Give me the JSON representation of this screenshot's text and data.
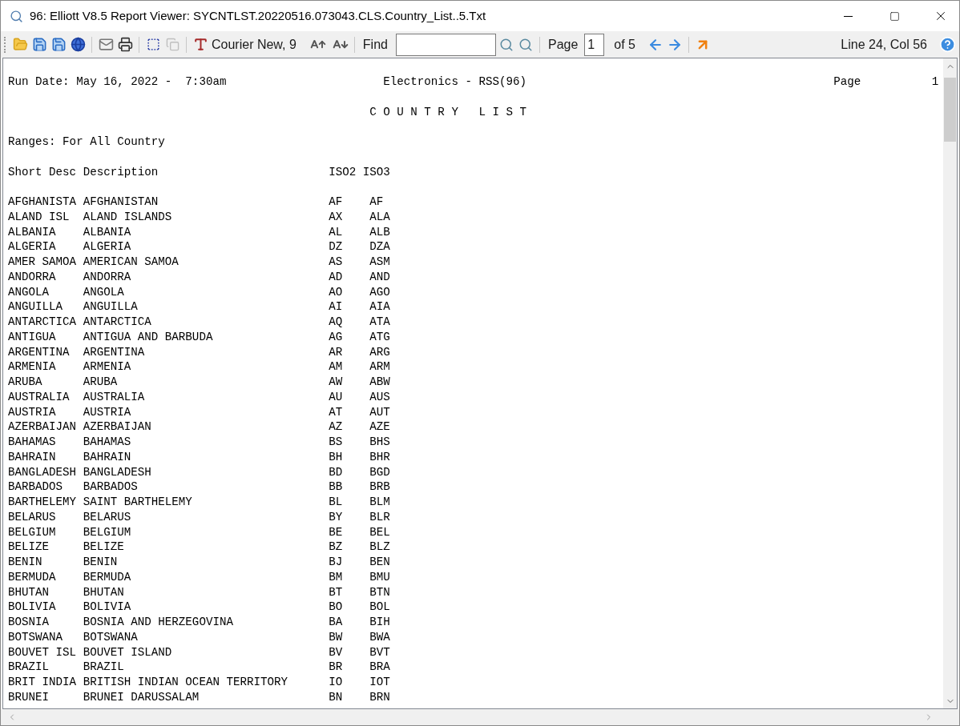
{
  "window": {
    "title": "96: Elliott V8.5 Report Viewer: SYCNTLST.20220516.073043.CLS.Country_List..5.Txt"
  },
  "toolbar": {
    "font_label": "Courier New, 9",
    "copy_disabled": true,
    "find_label": "Find",
    "page_label": "Page",
    "page_value": "1",
    "page_of": "of 5",
    "position": "Line 24, Col 56"
  },
  "report": {
    "run_date": "Run Date: May 16, 2022 -  7:30am",
    "company": "Electronics - RSS(96)",
    "page_label": "Page",
    "page_number": "1",
    "title": "C O U N T R Y   L I S T",
    "ranges": "Ranges: For All Country",
    "columns": [
      "Short Desc",
      "Description",
      "ISO2",
      "ISO3"
    ],
    "rows": [
      {
        "short": "AFGHANISTA",
        "description": "AFGHANISTAN",
        "iso2": "AF",
        "iso3": "AF"
      },
      {
        "short": "ALAND ISL",
        "description": "ALAND ISLANDS",
        "iso2": "AX",
        "iso3": "ALA"
      },
      {
        "short": "ALBANIA",
        "description": "ALBANIA",
        "iso2": "AL",
        "iso3": "ALB"
      },
      {
        "short": "ALGERIA",
        "description": "ALGERIA",
        "iso2": "DZ",
        "iso3": "DZA"
      },
      {
        "short": "AMER SAMOA",
        "description": "AMERICAN SAMOA",
        "iso2": "AS",
        "iso3": "ASM"
      },
      {
        "short": "ANDORRA",
        "description": "ANDORRA",
        "iso2": "AD",
        "iso3": "AND"
      },
      {
        "short": "ANGOLA",
        "description": "ANGOLA",
        "iso2": "AO",
        "iso3": "AGO"
      },
      {
        "short": "ANGUILLA",
        "description": "ANGUILLA",
        "iso2": "AI",
        "iso3": "AIA"
      },
      {
        "short": "ANTARCTICA",
        "description": "ANTARCTICA",
        "iso2": "AQ",
        "iso3": "ATA"
      },
      {
        "short": "ANTIGUA",
        "description": "ANTIGUA AND BARBUDA",
        "iso2": "AG",
        "iso3": "ATG"
      },
      {
        "short": "ARGENTINA",
        "description": "ARGENTINA",
        "iso2": "AR",
        "iso3": "ARG"
      },
      {
        "short": "ARMENIA",
        "description": "ARMENIA",
        "iso2": "AM",
        "iso3": "ARM"
      },
      {
        "short": "ARUBA",
        "description": "ARUBA",
        "iso2": "AW",
        "iso3": "ABW"
      },
      {
        "short": "AUSTRALIA",
        "description": "AUSTRALIA",
        "iso2": "AU",
        "iso3": "AUS"
      },
      {
        "short": "AUSTRIA",
        "description": "AUSTRIA",
        "iso2": "AT",
        "iso3": "AUT"
      },
      {
        "short": "AZERBAIJAN",
        "description": "AZERBAIJAN",
        "iso2": "AZ",
        "iso3": "AZE"
      },
      {
        "short": "BAHAMAS",
        "description": "BAHAMAS",
        "iso2": "BS",
        "iso3": "BHS"
      },
      {
        "short": "BAHRAIN",
        "description": "BAHRAIN",
        "iso2": "BH",
        "iso3": "BHR"
      },
      {
        "short": "BANGLADESH",
        "description": "BANGLADESH",
        "iso2": "BD",
        "iso3": "BGD"
      },
      {
        "short": "BARBADOS",
        "description": "BARBADOS",
        "iso2": "BB",
        "iso3": "BRB"
      },
      {
        "short": "BARTHELEMY",
        "description": "SAINT BARTHELEMY",
        "iso2": "BL",
        "iso3": "BLM"
      },
      {
        "short": "BELARUS",
        "description": "BELARUS",
        "iso2": "BY",
        "iso3": "BLR"
      },
      {
        "short": "BELGIUM",
        "description": "BELGIUM",
        "iso2": "BE",
        "iso3": "BEL"
      },
      {
        "short": "BELIZE",
        "description": "BELIZE",
        "iso2": "BZ",
        "iso3": "BLZ"
      },
      {
        "short": "BENIN",
        "description": "BENIN",
        "iso2": "BJ",
        "iso3": "BEN"
      },
      {
        "short": "BERMUDA",
        "description": "BERMUDA",
        "iso2": "BM",
        "iso3": "BMU"
      },
      {
        "short": "BHUTAN",
        "description": "BHUTAN",
        "iso2": "BT",
        "iso3": "BTN"
      },
      {
        "short": "BOLIVIA",
        "description": "BOLIVIA",
        "iso2": "BO",
        "iso3": "BOL"
      },
      {
        "short": "BOSNIA",
        "description": "BOSNIA AND HERZEGOVINA",
        "iso2": "BA",
        "iso3": "BIH"
      },
      {
        "short": "BOTSWANA",
        "description": "BOTSWANA",
        "iso2": "BW",
        "iso3": "BWA"
      },
      {
        "short": "BOUVET ISL",
        "description": "BOUVET ISLAND",
        "iso2": "BV",
        "iso3": "BVT"
      },
      {
        "short": "BRAZIL",
        "description": "BRAZIL",
        "iso2": "BR",
        "iso3": "BRA"
      },
      {
        "short": "BRIT INDIA",
        "description": "BRITISH INDIAN OCEAN TERRITORY",
        "iso2": "IO",
        "iso3": "IOT"
      },
      {
        "short": "BRUNEI",
        "description": "BRUNEI DARUSSALAM",
        "iso2": "BN",
        "iso3": "BRN"
      }
    ]
  }
}
